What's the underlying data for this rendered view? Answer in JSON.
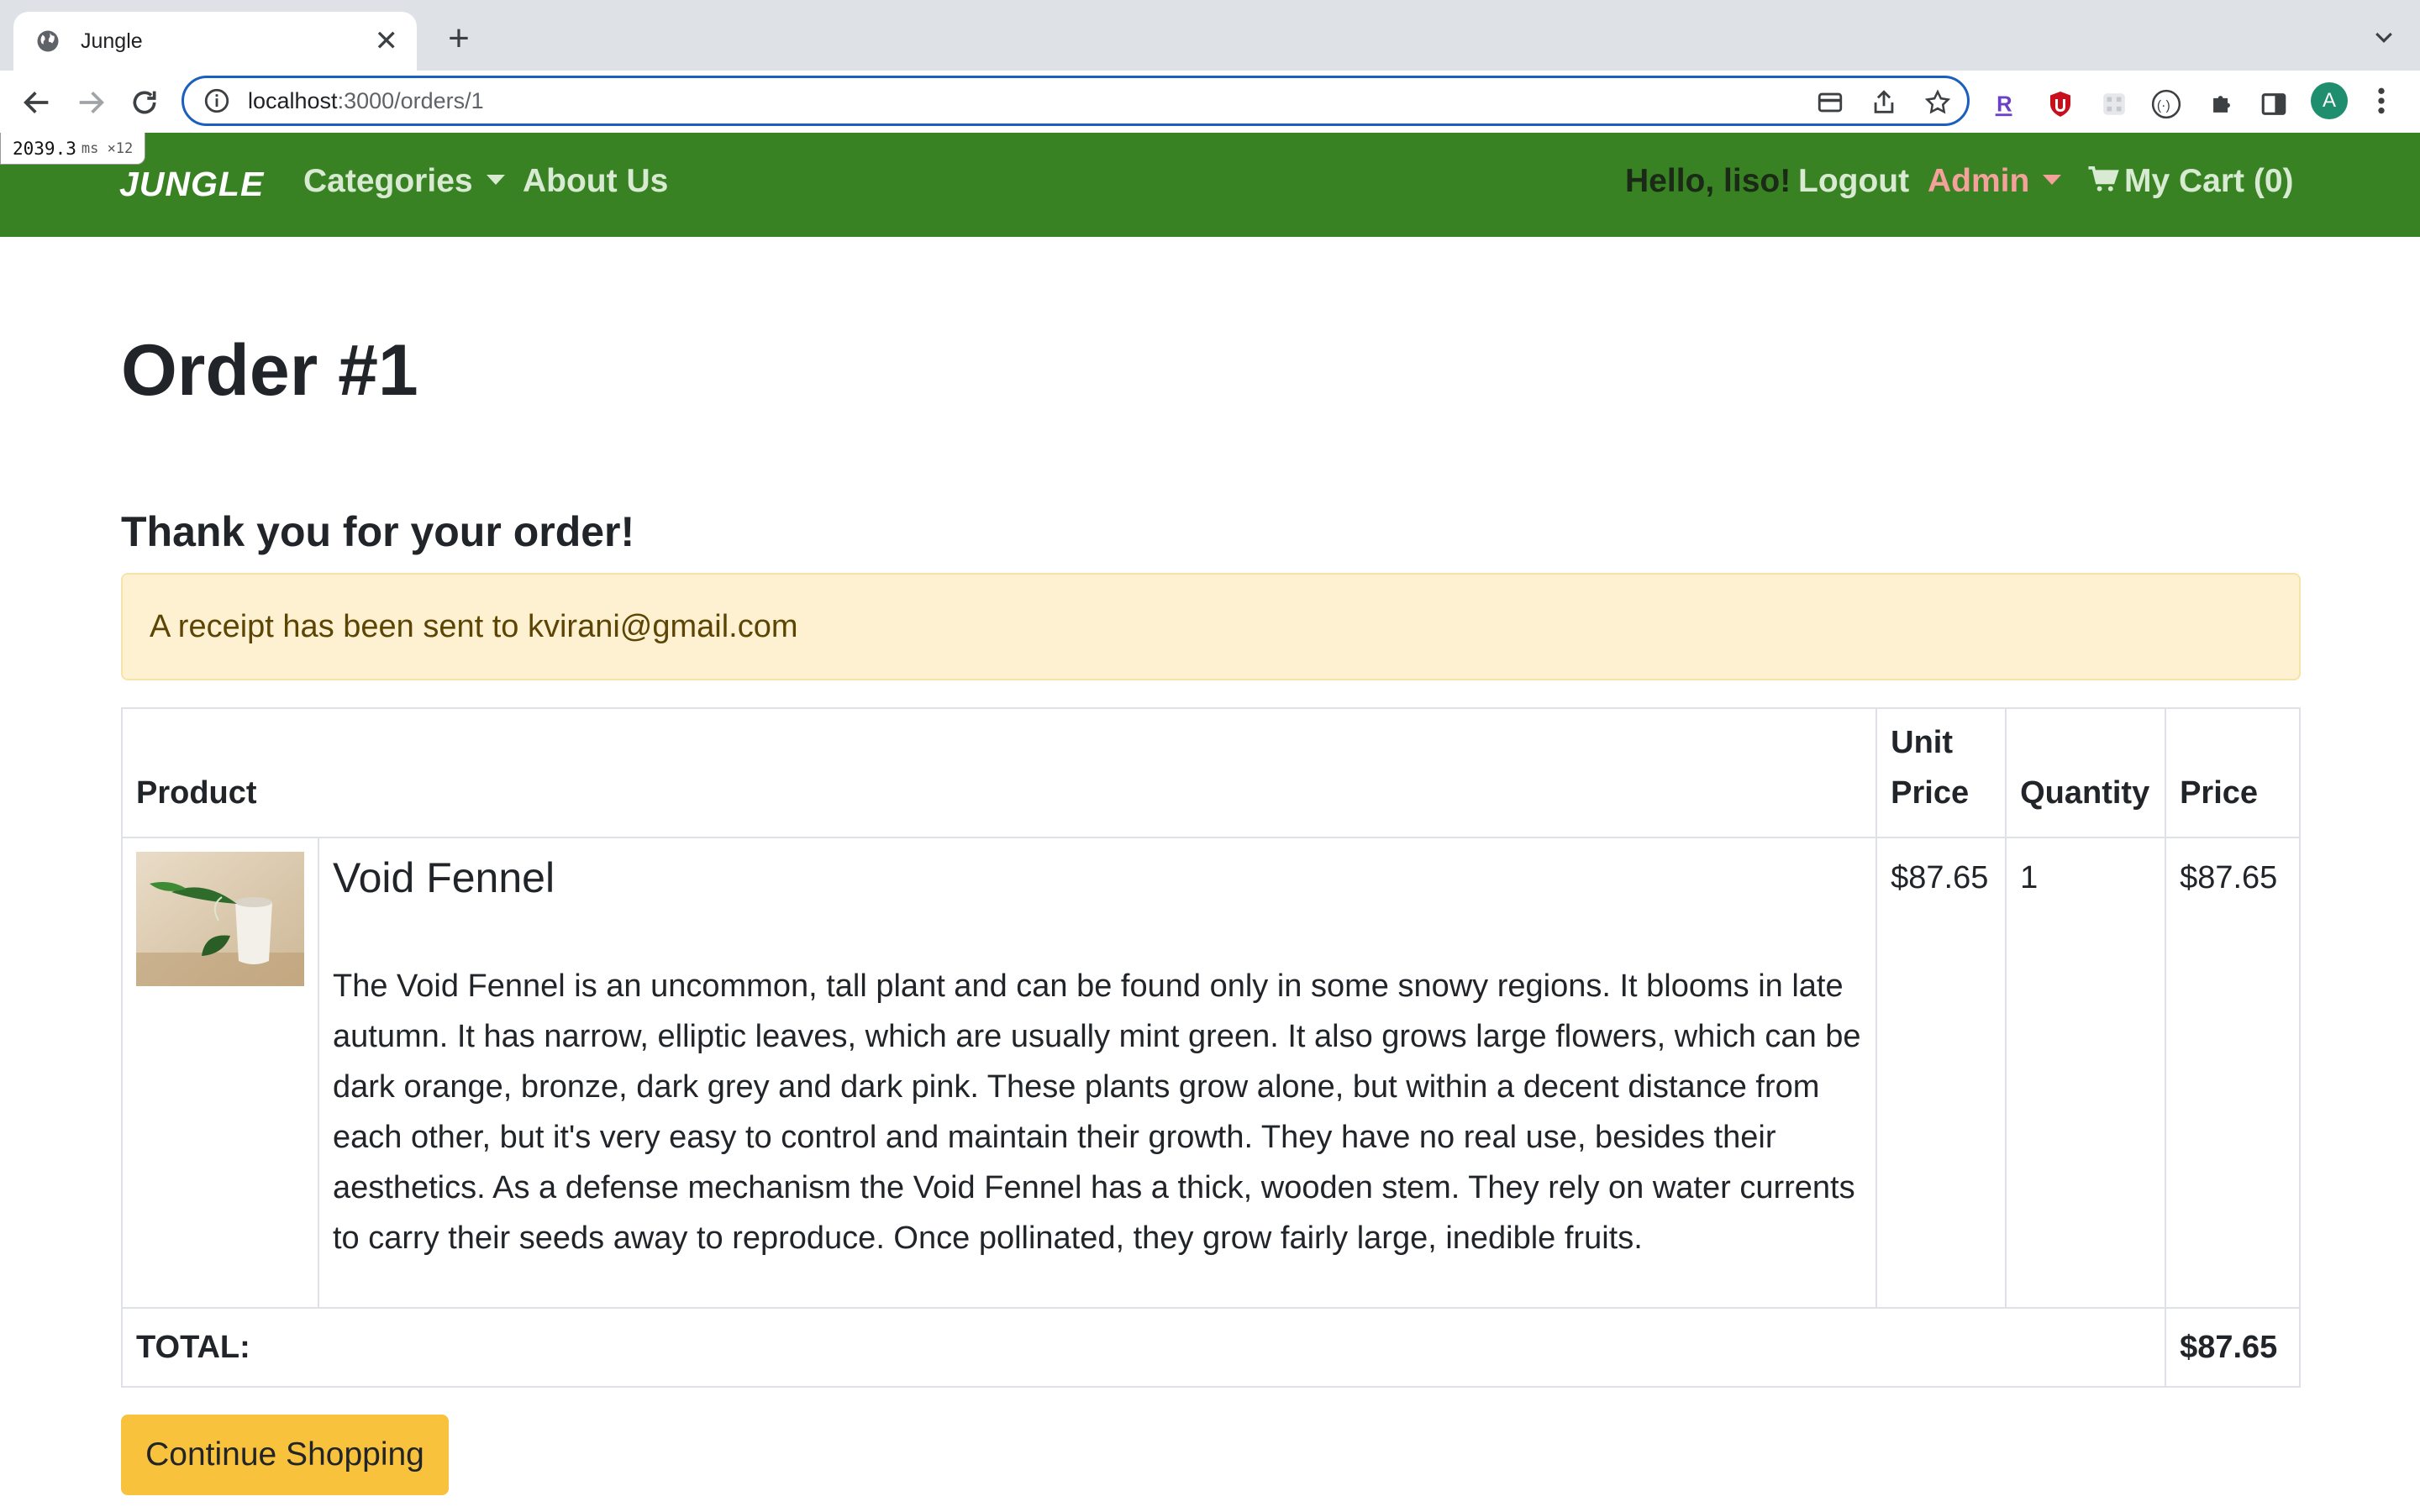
{
  "browser": {
    "tab_title": "Jungle",
    "tab_close": "✕",
    "new_tab": "+",
    "url_host": "localhost",
    "url_rest": ":3000/orders/1",
    "avatar_initial": "A"
  },
  "perf_badge": {
    "value": "2039.3",
    "unit": "ms ×12"
  },
  "navbar": {
    "brand": "JUNGLE",
    "categories": "Categories",
    "about": "About Us",
    "hello": "Hello, liso!",
    "logout": "Logout",
    "admin": "Admin",
    "cart": "My Cart (0)"
  },
  "order": {
    "title": "Order #1",
    "thanks": "Thank you for your order!",
    "receipt": "A receipt has been sent to kvirani@gmail.com",
    "headers": {
      "product": "Product",
      "unit_price_1": "Unit",
      "unit_price_2": "Price",
      "quantity": "Quantity",
      "price": "Price"
    },
    "items": [
      {
        "name": "Void Fennel",
        "description": "The Void Fennel is an uncommon, tall plant and can be found only in some snowy regions. It blooms in late autumn. It has narrow, elliptic leaves, which are usually mint green. It also grows large flowers, which can be dark orange, bronze, dark grey and dark pink. These plants grow alone, but within a decent distance from each other, but it's very easy to control and maintain their growth. They have no real use, besides their aesthetics. As a defense mechanism the Void Fennel has a thick, wooden stem. They rely on water currents to carry their seeds away to reproduce. Once pollinated, they grow fairly large, inedible fruits.",
        "unit_price": "$87.65",
        "quantity": "1",
        "price": "$87.65"
      }
    ],
    "total_label": "TOTAL:",
    "total_value": "$87.65",
    "continue_button": "Continue Shopping"
  },
  "colors": {
    "navbar": "#388223",
    "alert_bg": "#fdf1d2",
    "button": "#f8c23c",
    "admin": "#f4a09b"
  }
}
